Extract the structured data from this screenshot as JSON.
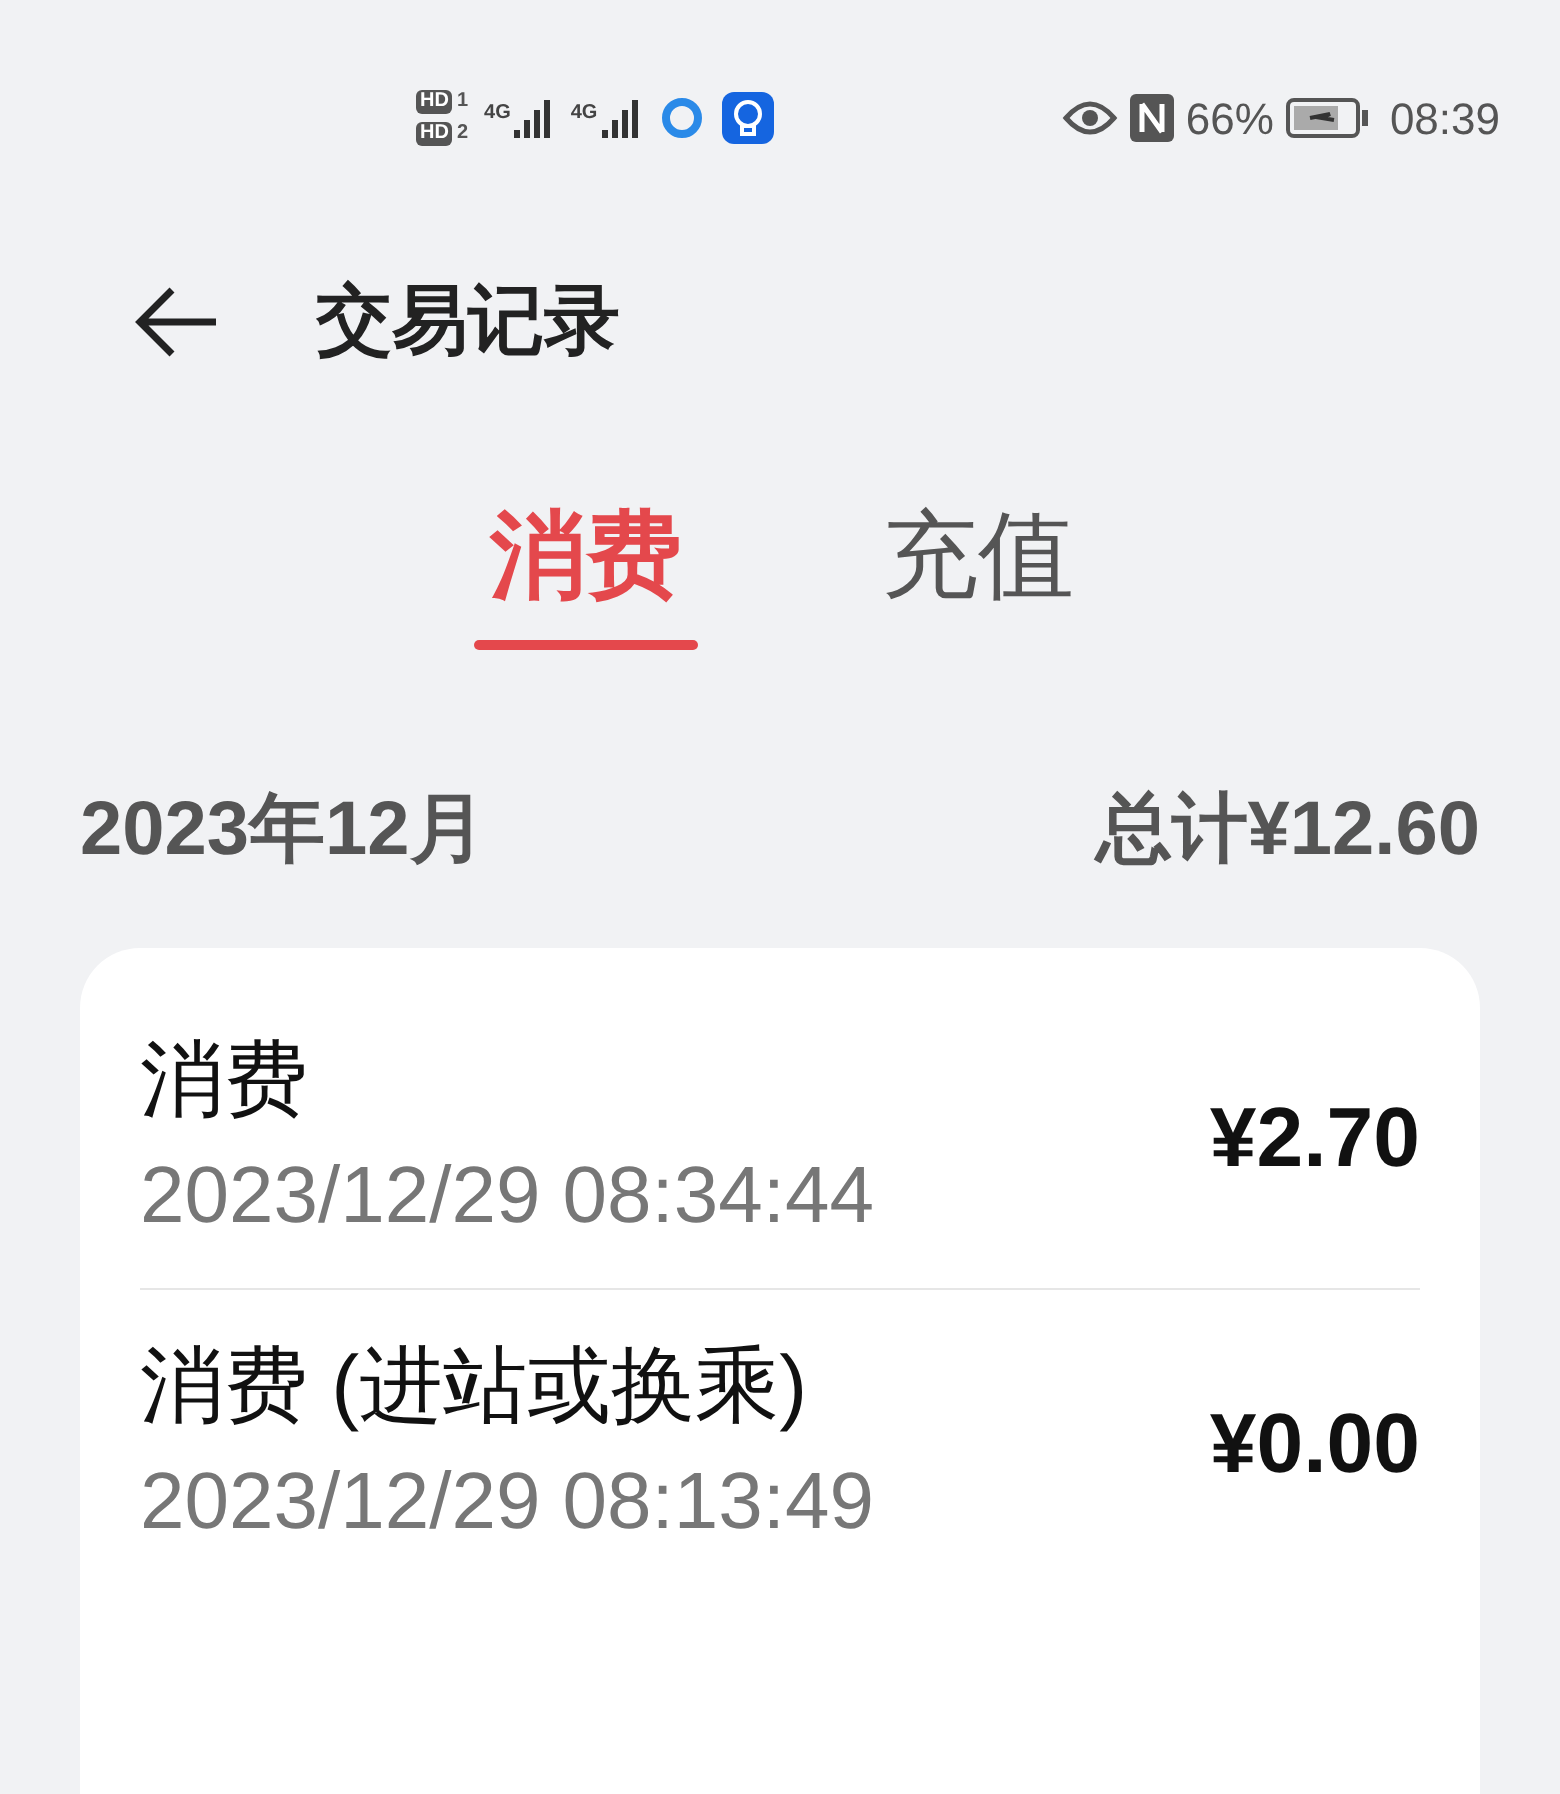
{
  "status_bar": {
    "sims": [
      {
        "badge": "HD",
        "slot": "1",
        "network": "4G"
      },
      {
        "badge": "HD",
        "slot": "2",
        "network": "4G"
      }
    ],
    "battery": "66%",
    "time": "08:39"
  },
  "header": {
    "title": "交易记录"
  },
  "tabs": [
    {
      "label": "消费",
      "selected": true
    },
    {
      "label": "充值",
      "selected": false
    }
  ],
  "summary": {
    "month": "2023年12月",
    "total": "总计¥12.60"
  },
  "transactions": [
    {
      "title": "消费",
      "datetime": "2023/12/29 08:34:44",
      "amount": "¥2.70"
    },
    {
      "title": "消费 (进站或换乘)",
      "datetime": "2023/12/29 08:13:49",
      "amount": "¥0.00"
    }
  ]
}
